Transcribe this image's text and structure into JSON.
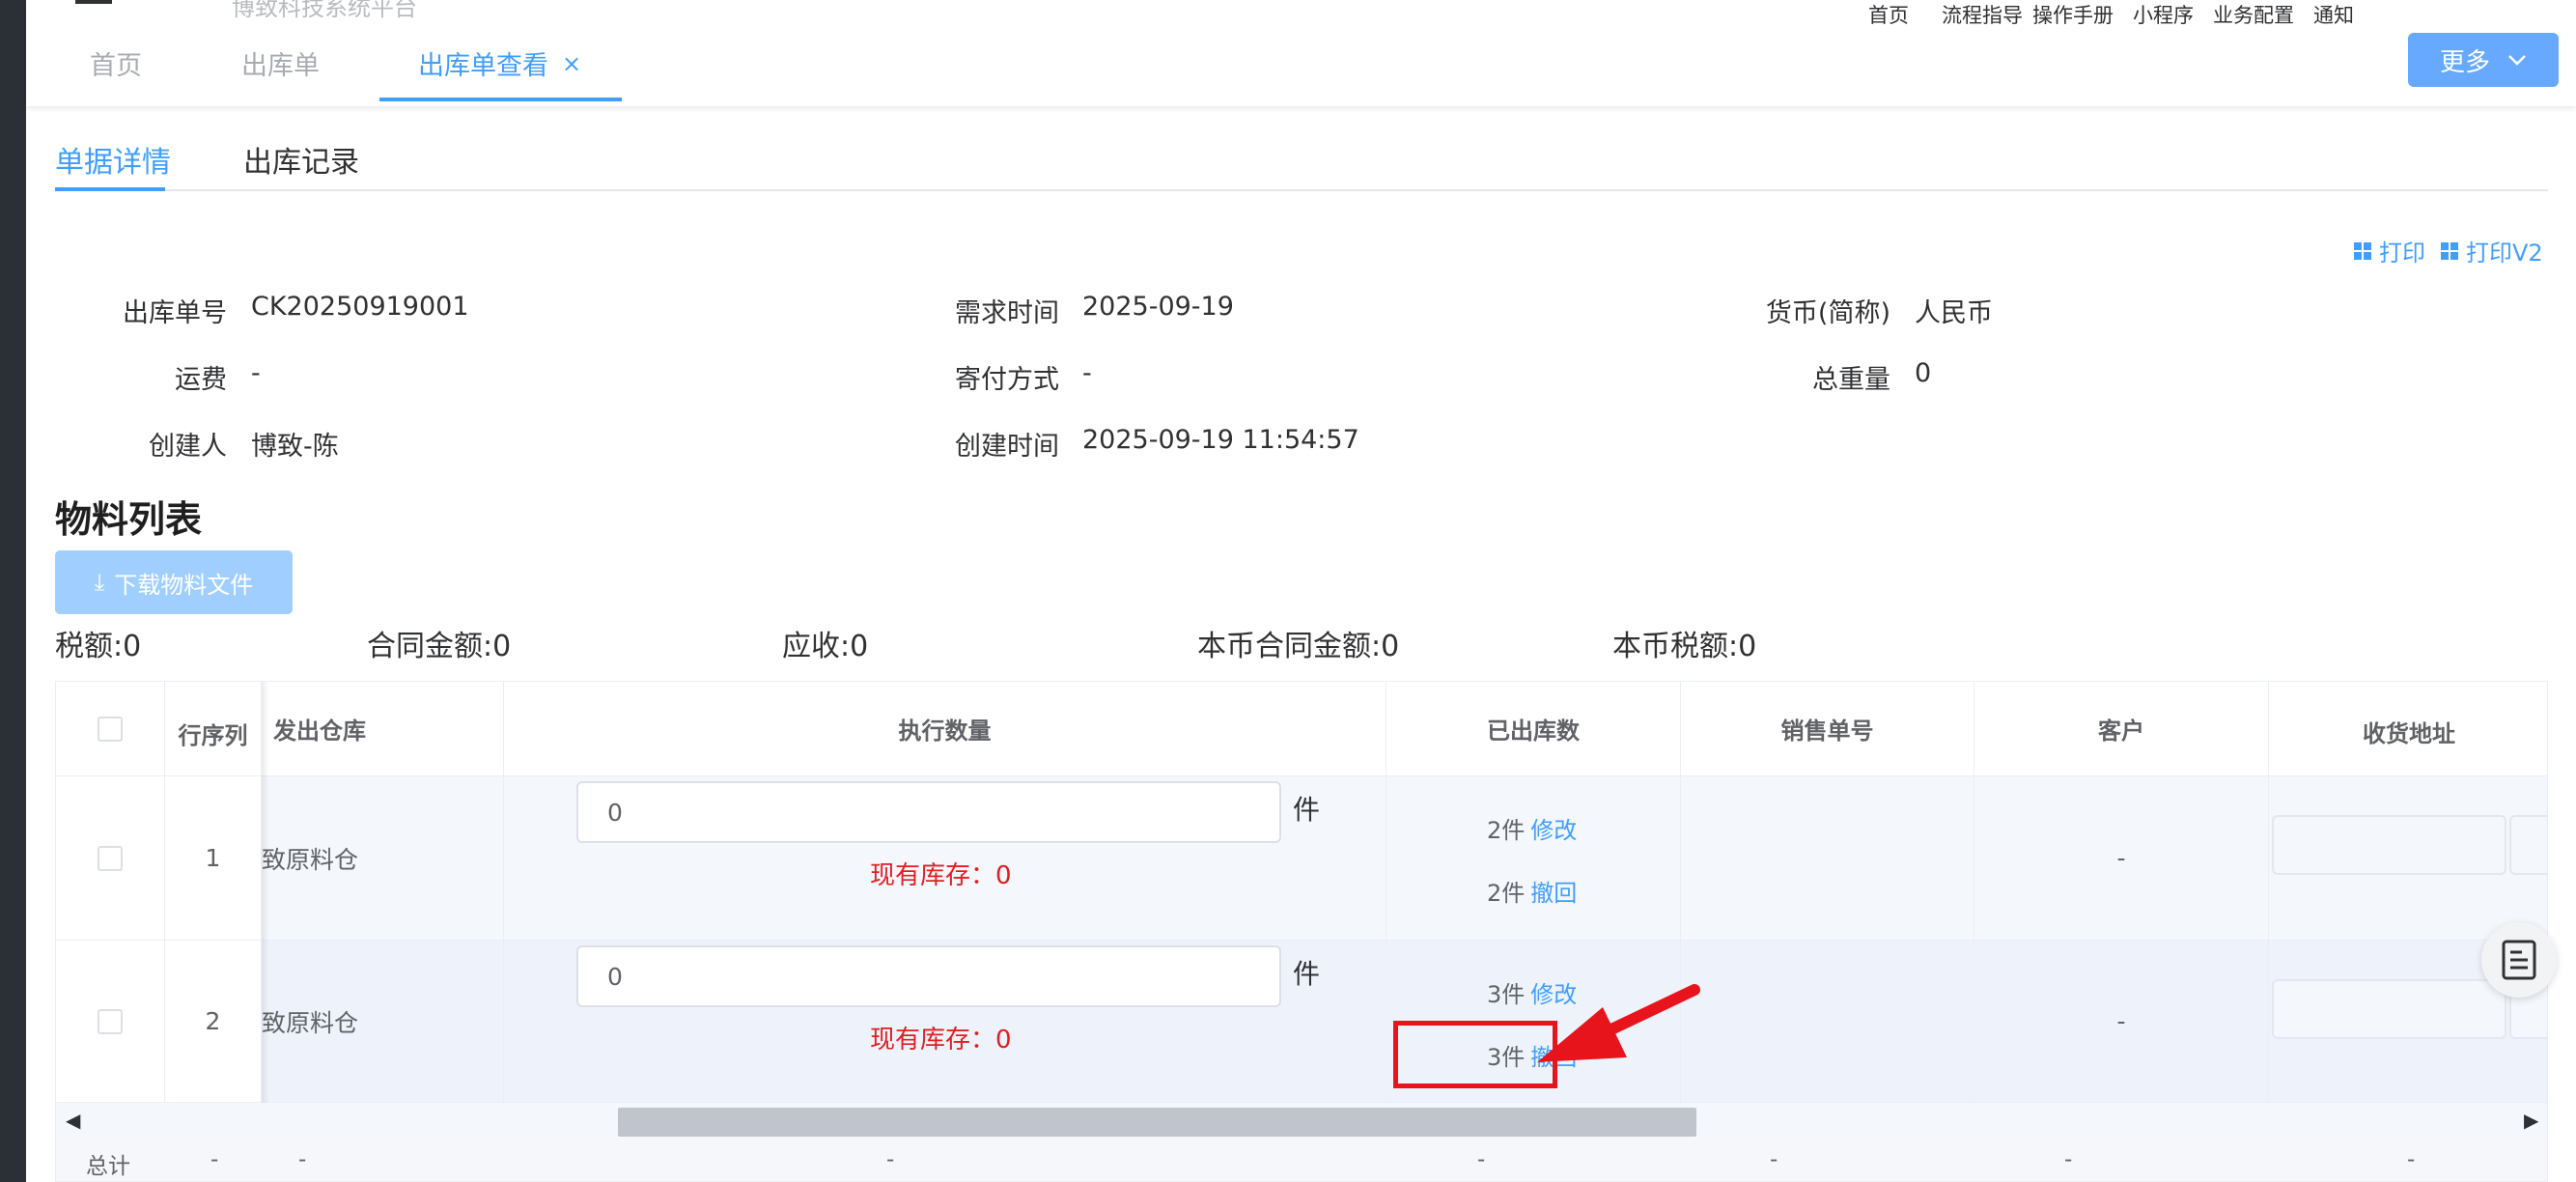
{
  "topbar": {
    "blurred_title": "博致科技系统平台",
    "links": [
      "首页",
      "流程指导",
      "操作手册",
      "小程序",
      "业务配置",
      "通知"
    ],
    "more_label": "更多"
  },
  "tabs": [
    {
      "label": "首页"
    },
    {
      "label": "出库单"
    },
    {
      "label": "出库单查看",
      "close": "×"
    }
  ],
  "subtabs": [
    "单据详情",
    "出库记录"
  ],
  "print": {
    "print_label": "打印",
    "print_v2_label": "打印V2"
  },
  "details": {
    "col1": [
      {
        "label": "出库单号",
        "value": "CK20250919001"
      },
      {
        "label": "运费",
        "value": "-"
      },
      {
        "label": "创建人",
        "value": "博致-陈"
      }
    ],
    "col2": [
      {
        "label": "需求时间",
        "value": "2025-09-19"
      },
      {
        "label": "寄付方式",
        "value": "-"
      },
      {
        "label": "创建时间",
        "value": "2025-09-19 11:54:57"
      }
    ],
    "col3": [
      {
        "label": "货币(简称)",
        "value": "人民币"
      },
      {
        "label": "总重量",
        "value": "0"
      }
    ]
  },
  "materials": {
    "title": "物料列表",
    "download_label": "下载物料文件",
    "summary": [
      "税额:0",
      "合同金额:0",
      "应收:0",
      "本币合同金额:0",
      "本币税额:0"
    ]
  },
  "table": {
    "headers": [
      "行序列",
      "发出仓库",
      "执行数量",
      "已出库数",
      "销售单号",
      "客户",
      "收货地址"
    ],
    "rows": [
      {
        "index": "1",
        "warehouse": "致原料仓",
        "qty": "0",
        "unit": "件",
        "stock": "现有库存：0",
        "ship1_qty": "2件",
        "ship1_action": "修改",
        "ship2_qty": "2件",
        "ship2_action": "撤回",
        "sales_no": "",
        "customer": "-"
      },
      {
        "index": "2",
        "warehouse": "致原料仓",
        "qty": "0",
        "unit": "件",
        "stock": "现有库存：0",
        "ship1_qty": "3件",
        "ship1_action": "修改",
        "ship2_qty": "3件",
        "ship2_action": "撤回",
        "sales_no": "",
        "customer": "-"
      }
    ],
    "footer": [
      "总计",
      "-",
      "-",
      "-",
      "-",
      "-",
      "-",
      "-"
    ]
  },
  "colors": {
    "accent": "#409eff",
    "danger": "#e02020",
    "annotation": "#e8141c"
  }
}
